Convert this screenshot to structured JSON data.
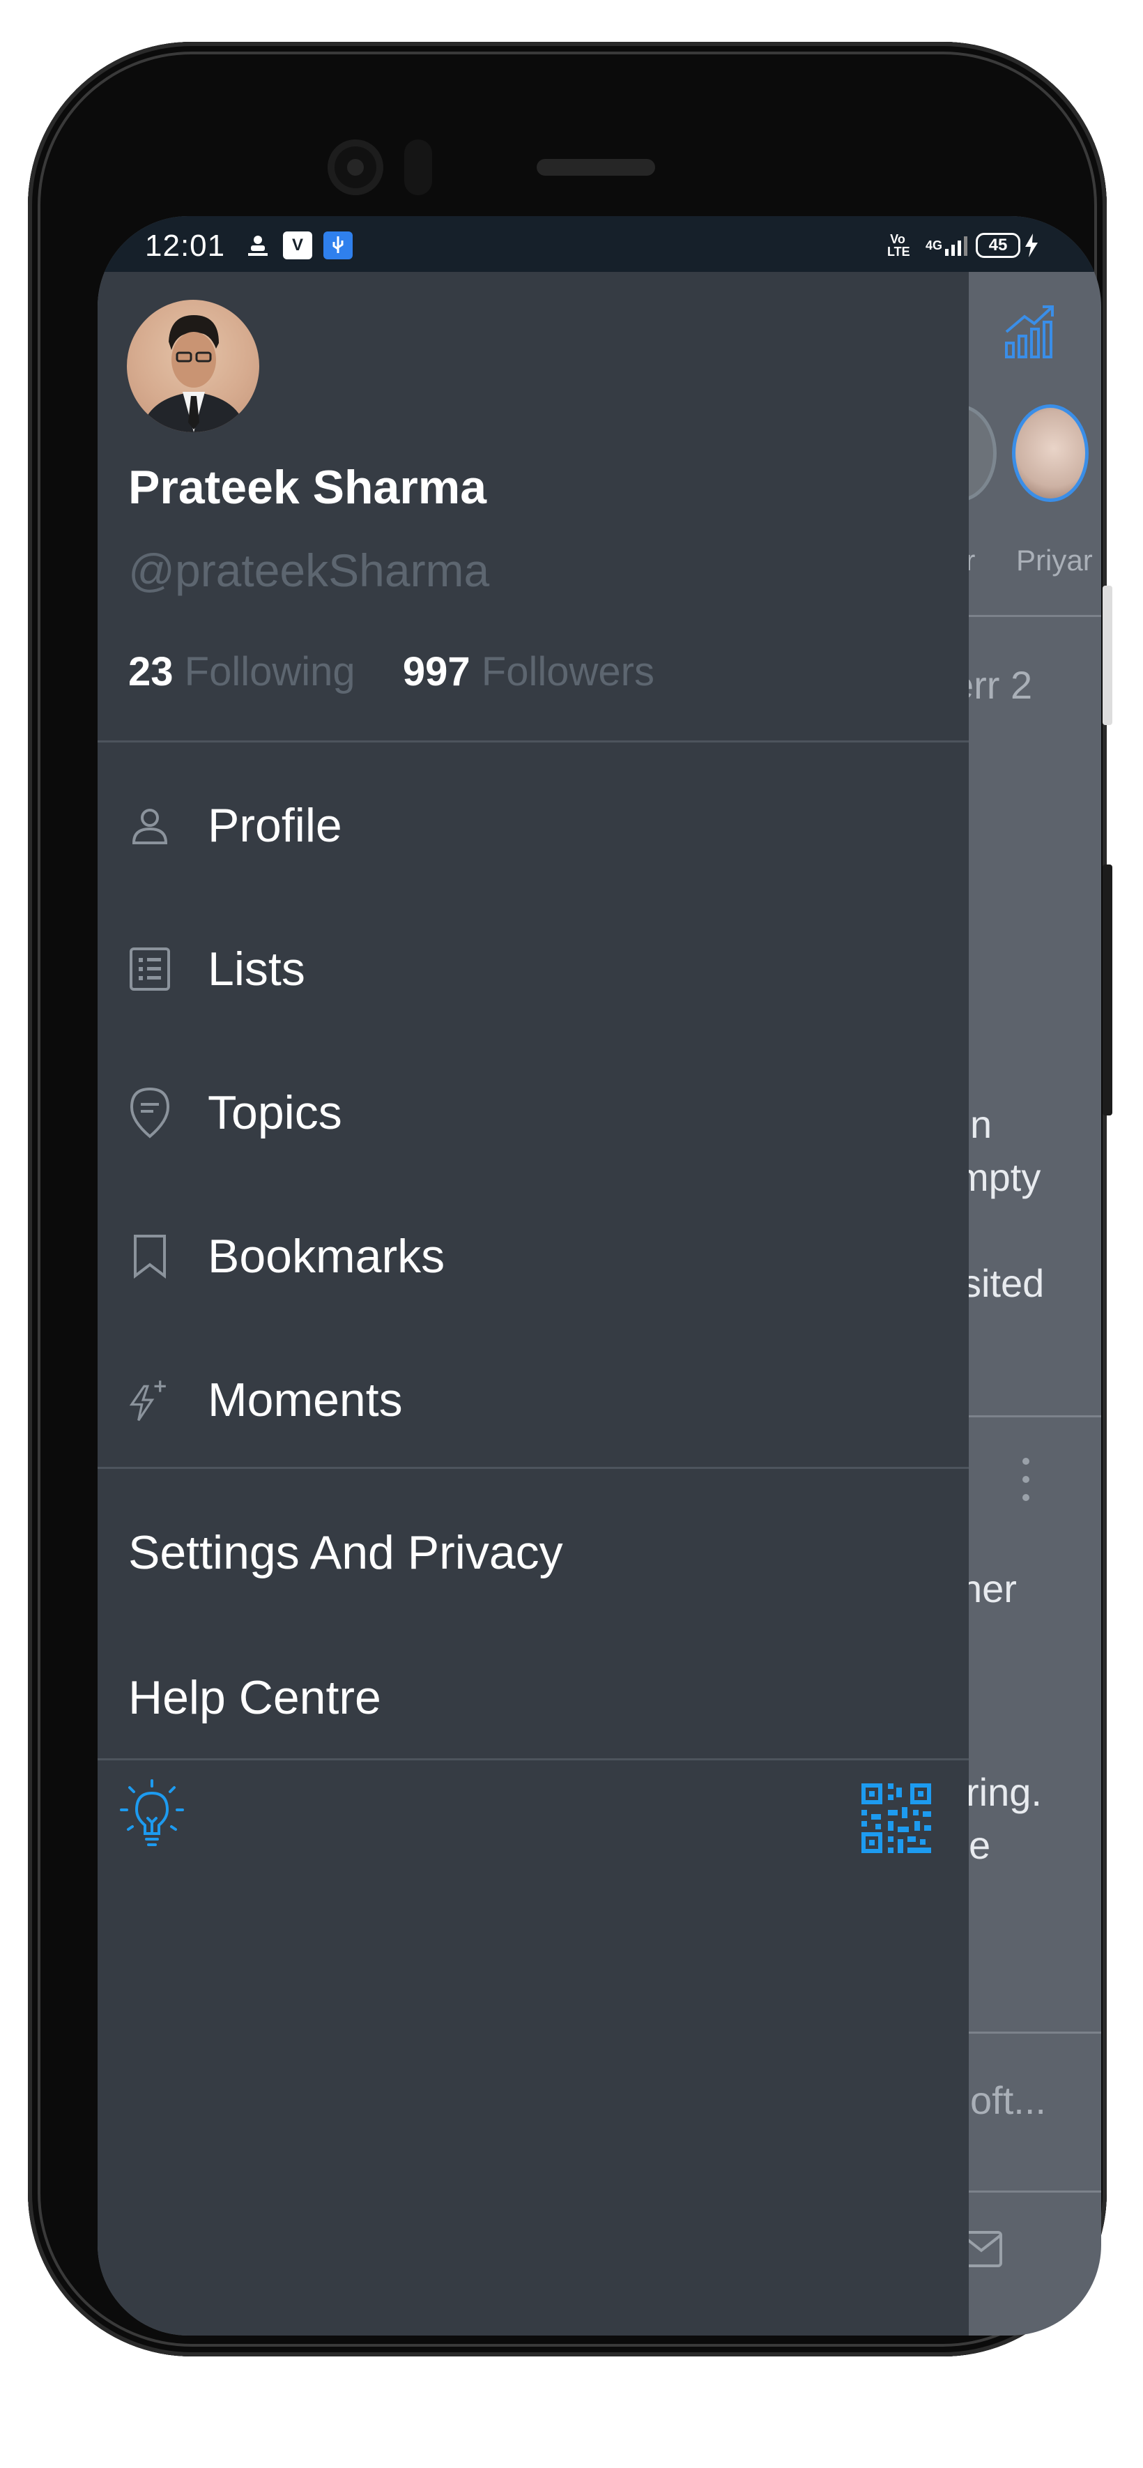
{
  "status_bar": {
    "time": "12:01",
    "network_volte": "Vo LTE",
    "network_4g": "4G",
    "battery_level": "45"
  },
  "profile": {
    "display_name": "Prateek Sharma",
    "handle": "@prateekSharma",
    "following_count": "23",
    "following_label": "Following",
    "followers_count": "997",
    "followers_label": "Followers"
  },
  "menu": {
    "items": [
      {
        "label": "Profile",
        "icon": "person-icon"
      },
      {
        "label": "Lists",
        "icon": "list-icon"
      },
      {
        "label": "Topics",
        "icon": "topic-icon"
      },
      {
        "label": "Bookmarks",
        "icon": "bookmark-icon"
      },
      {
        "label": "Moments",
        "icon": "moments-icon"
      }
    ],
    "settings_label": "Settings And Privacy",
    "help_label": "Help Centre"
  },
  "bottom_bar": {
    "left_icon": "lightbulb-icon",
    "right_icon": "qr-code-icon",
    "accent_color": "#1d9bf0"
  },
  "background_timeline": {
    "fleet_names": [
      "ur",
      "Priyar"
    ],
    "texts": [
      "err 2",
      "n",
      "mpty",
      "sited",
      "her",
      "ring.",
      "e",
      "oft..."
    ]
  },
  "colors": {
    "drawer_bg": "#363c44",
    "muted_text": "#5d6670",
    "accent": "#1d9bf0"
  }
}
